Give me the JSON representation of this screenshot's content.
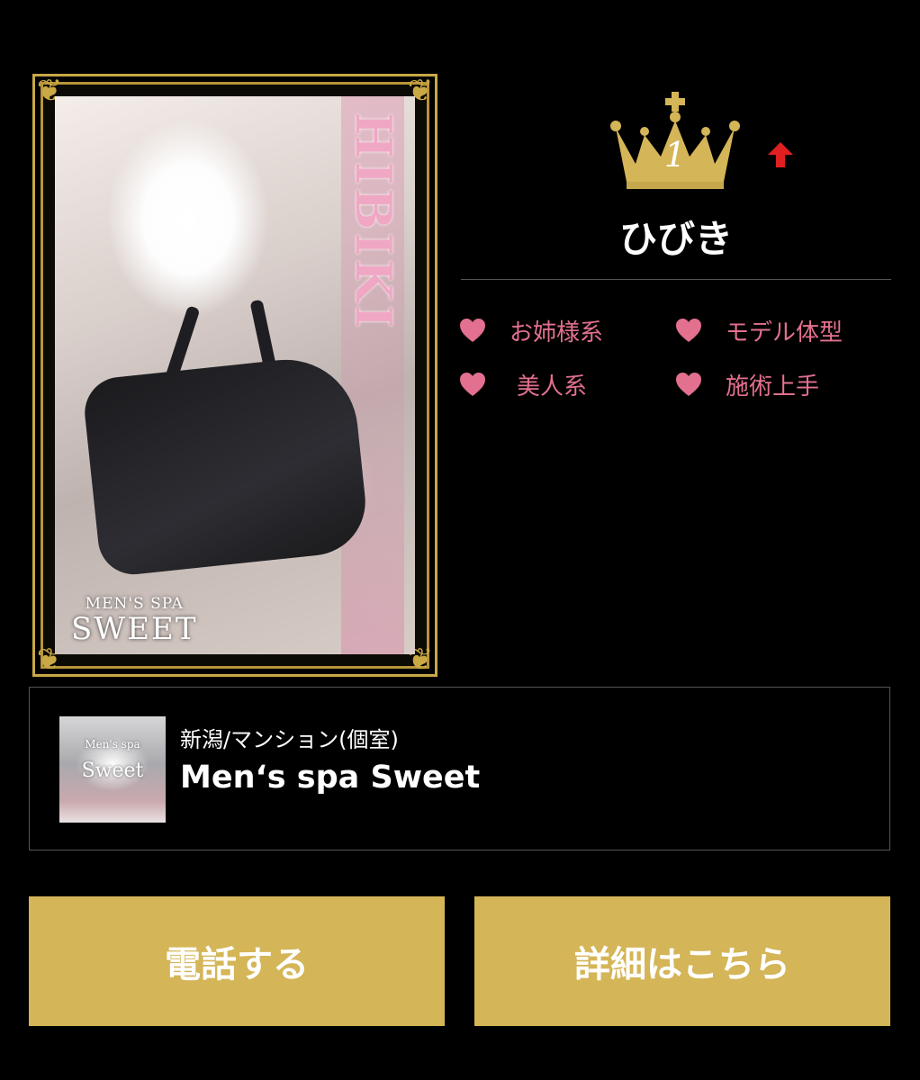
{
  "card": {
    "vertical_name": "HIBIKI",
    "brand_sub": "MEN'S SPA",
    "brand_main": "SWEET"
  },
  "rank": {
    "number": "1",
    "trend": "up",
    "trend_color": "#e02020",
    "crown_color": "#d4b557"
  },
  "therapist": {
    "name": "ひびき",
    "tags": [
      "お姉様系",
      "モデル体型",
      "美人系",
      "施術上手"
    ],
    "tag_color": "#e2708e"
  },
  "shop": {
    "area": "新潟/マンション(個室)",
    "name": "Men‘s spa Sweet",
    "thumb_logo_sub": "Men's spa",
    "thumb_logo_main": "Sweet"
  },
  "buttons": {
    "call_label": "電話する",
    "detail_label": "詳細はこちら",
    "color": "#d4b557"
  }
}
